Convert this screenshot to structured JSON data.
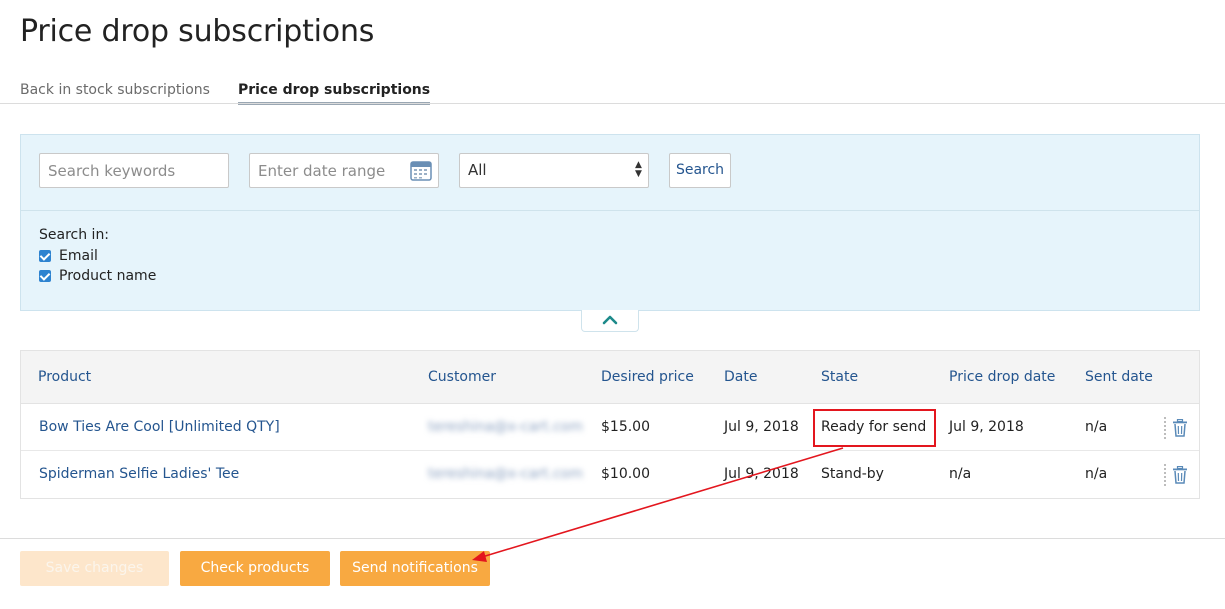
{
  "page": {
    "title": "Price drop subscriptions"
  },
  "tabs": [
    {
      "label": "Back in stock subscriptions",
      "active": false
    },
    {
      "label": "Price drop subscriptions",
      "active": true
    }
  ],
  "filters": {
    "keywords_placeholder": "Search keywords",
    "date_placeholder": "Enter date range",
    "state_select_value": "All",
    "search_button": "Search",
    "search_in_label": "Search in:",
    "checkboxes": [
      {
        "label": "Email",
        "checked": true
      },
      {
        "label": "Product name",
        "checked": true
      }
    ]
  },
  "table": {
    "columns": [
      "Product",
      "Customer",
      "Desired price",
      "Date",
      "State",
      "Price drop date",
      "Sent date"
    ],
    "rows": [
      {
        "product": "Bow Ties Are Cool [Unlimited QTY]",
        "customer": "tereshina@x-cart.com",
        "desired_price": "$15.00",
        "date": "Jul 9, 2018",
        "state": "Ready for send",
        "price_drop_date": "Jul 9, 2018",
        "sent_date": "n/a"
      },
      {
        "product": "Spiderman Selfie Ladies' Tee",
        "customer": "tereshina@x-cart.com",
        "desired_price": "$10.00",
        "date": "Jul 9, 2018",
        "state": "Stand-by",
        "price_drop_date": "n/a",
        "sent_date": "n/a"
      }
    ]
  },
  "footer": {
    "save_label": "Save changes",
    "check_label": "Check products",
    "send_label": "Send notifications"
  },
  "colors": {
    "accent_orange": "#f8a941",
    "link_blue": "#24558f",
    "panel_blue": "#e6f4fb",
    "annotation_red": "#e3161e"
  },
  "icons": [
    "calendar-icon",
    "chevron-up-icon",
    "trash-icon",
    "select-arrows-icon"
  ]
}
